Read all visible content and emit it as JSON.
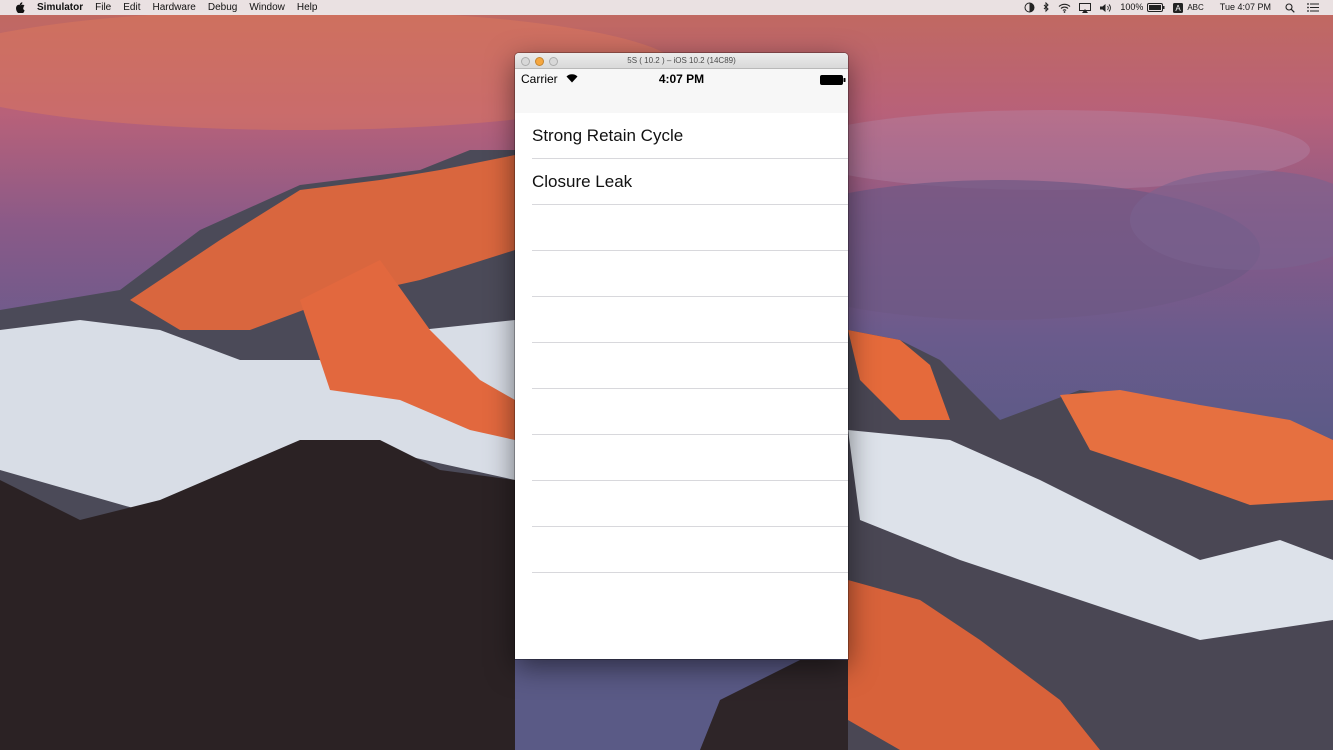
{
  "menubar": {
    "app_name": "Simulator",
    "items": [
      "File",
      "Edit",
      "Hardware",
      "Debug",
      "Window",
      "Help"
    ],
    "battery_percent": "100%",
    "input_source": "ABC",
    "clock": "Tue 4:07 PM"
  },
  "window": {
    "title": "5S ( 10.2 ) – iOS 10.2 (14C89)"
  },
  "device": {
    "carrier": "Carrier",
    "time": "4:07 PM"
  },
  "table": {
    "rows": [
      "Strong Retain Cycle",
      "Closure Leak",
      "",
      "",
      "",
      "",
      "",
      "",
      "",
      "",
      "",
      ""
    ]
  },
  "colors": {
    "desktop_sunset": "#c86a5a",
    "mountain_glow": "#e0603a",
    "window_bg": "#ffffff",
    "status_bar_bg": "#f7f7f7",
    "separator": "#d8d8dc"
  }
}
